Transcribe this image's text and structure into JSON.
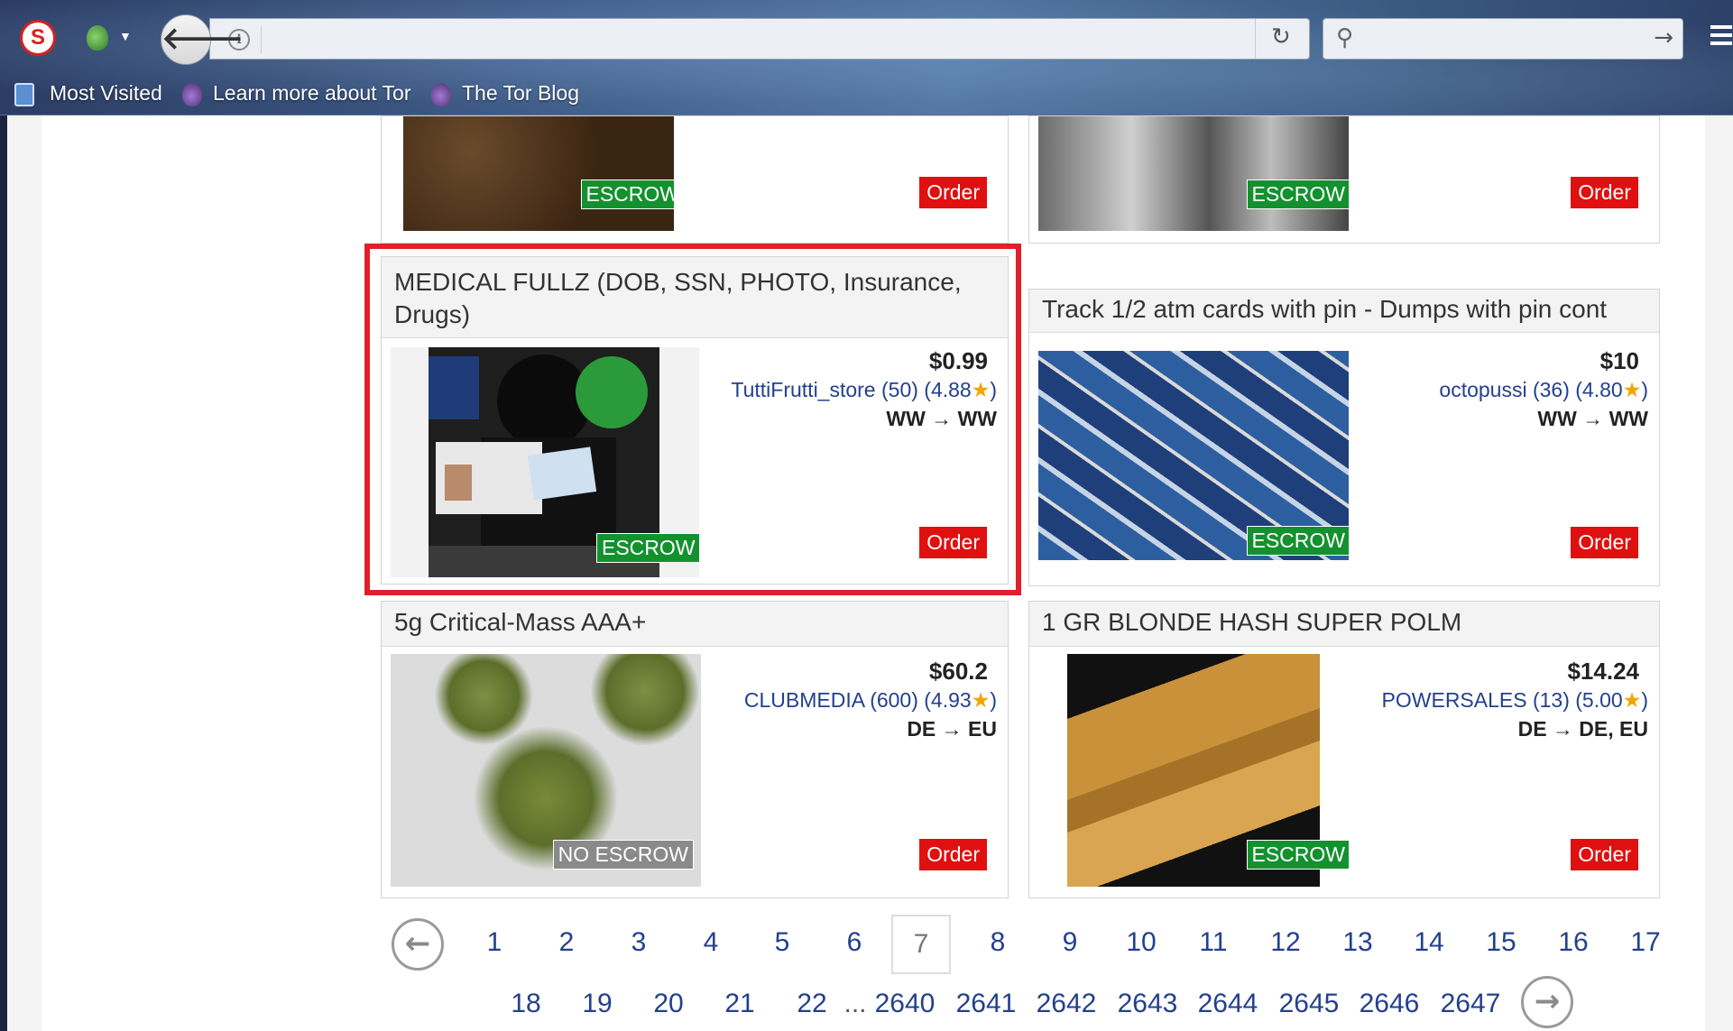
{
  "browser": {
    "bookmarks": [
      "Most Visited",
      "Learn more about Tor",
      "The Tor Blog"
    ],
    "url": ""
  },
  "listings": [
    {
      "title": "",
      "badge": "ESCROW",
      "order_label": "Order"
    },
    {
      "title": "",
      "badge": "ESCROW",
      "order_label": "Order"
    },
    {
      "title": "MEDICAL FULLZ (DOB, SSN, PHOTO, Insurance, Drugs)",
      "price": "$0.99",
      "seller": "TuttiFrutti_store (50) (4.88",
      "seller_suffix": ")",
      "shipping": "WW → WW",
      "badge": "ESCROW",
      "order_label": "Order"
    },
    {
      "title": "Track 1/2 atm cards with pin - Dumps with pin cont",
      "price": "$10",
      "seller": "octopussi (36) (4.80",
      "seller_suffix": ")",
      "shipping": "WW → WW",
      "badge": "ESCROW",
      "order_label": "Order"
    },
    {
      "title": "5g Critical-Mass AAA+",
      "price": "$60.2",
      "seller": "CLUBMEDIA (600) (4.93",
      "seller_suffix": ")",
      "shipping": "DE → EU",
      "badge": "NO ESCROW",
      "order_label": "Order"
    },
    {
      "title": "1 GR BLONDE HASH SUPER POLM",
      "price": "$14.24",
      "seller": "POWERSALES (13) (5.00",
      "seller_suffix": ")",
      "shipping": "DE → DE, EU",
      "badge": "ESCROW",
      "order_label": "Order"
    }
  ],
  "pagination": {
    "row1": [
      "1",
      "2",
      "3",
      "4",
      "5",
      "6",
      "7",
      "8",
      "9",
      "10",
      "11",
      "12",
      "13",
      "14",
      "15",
      "16",
      "17"
    ],
    "row2": [
      "18",
      "19",
      "20",
      "21",
      "22"
    ],
    "ellipsis": "...",
    "row3": [
      "2640",
      "2641",
      "2642",
      "2643",
      "2644",
      "2645",
      "2646",
      "2647"
    ],
    "current": "7"
  },
  "icons": {
    "back": "back-arrow-icon",
    "reload": "reload-icon",
    "search": "search-icon",
    "star": "star-icon"
  }
}
